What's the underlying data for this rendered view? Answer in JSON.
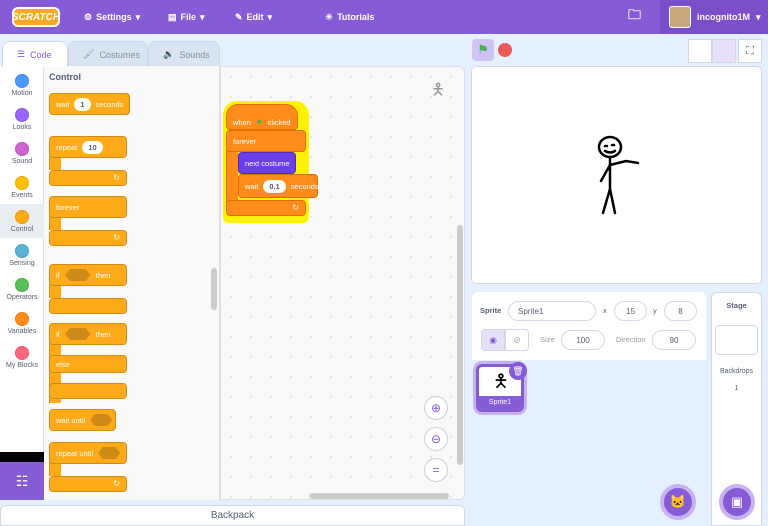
{
  "menu": {
    "logo": "SCRATCH",
    "settings": "Settings",
    "file": "File",
    "edit": "Edit",
    "tutorials": "Tutorials",
    "username": "incognito1M"
  },
  "tabs": [
    {
      "label": "Code"
    },
    {
      "label": "Costumes"
    },
    {
      "label": "Sounds"
    }
  ],
  "categories": [
    {
      "label": "Motion",
      "color": "#4c97ff"
    },
    {
      "label": "Looks",
      "color": "#9966ff"
    },
    {
      "label": "Sound",
      "color": "#cf63cf"
    },
    {
      "label": "Events",
      "color": "#ffbf00"
    },
    {
      "label": "Control",
      "color": "#ffab19"
    },
    {
      "label": "Sensing",
      "color": "#5cb1d6"
    },
    {
      "label": "Operators",
      "color": "#59c059"
    },
    {
      "label": "Variables",
      "color": "#ff8c1a"
    },
    {
      "label": "My Blocks",
      "color": "#ff6680"
    }
  ],
  "palette": {
    "heading": "Control",
    "wait": "wait",
    "wait_value": "1",
    "seconds": "seconds",
    "repeat": "repeat",
    "repeat_value": "10",
    "forever": "forever",
    "if": "if",
    "then": "then",
    "else": "else",
    "wait_until": "wait until",
    "repeat_until": "repeat until"
  },
  "script": {
    "when": "when",
    "clicked": "clicked",
    "forever": "forever",
    "next_costume": "next costume",
    "wait": "wait",
    "wait_value": "0.1",
    "seconds": "seconds"
  },
  "sprite_info": {
    "sprite_label": "Sprite",
    "sprite_name": "Sprite1",
    "x_label": "x",
    "x": "15",
    "y_label": "y",
    "y": "8",
    "size_label": "Size",
    "size": "100",
    "direction_label": "Direction",
    "direction": "90"
  },
  "sprites": [
    {
      "name": "Sprite1"
    }
  ],
  "stage_panel": {
    "title": "Stage",
    "backdrops_label": "Backdrops",
    "backdrops_count": "1"
  },
  "backpack": "Backpack"
}
